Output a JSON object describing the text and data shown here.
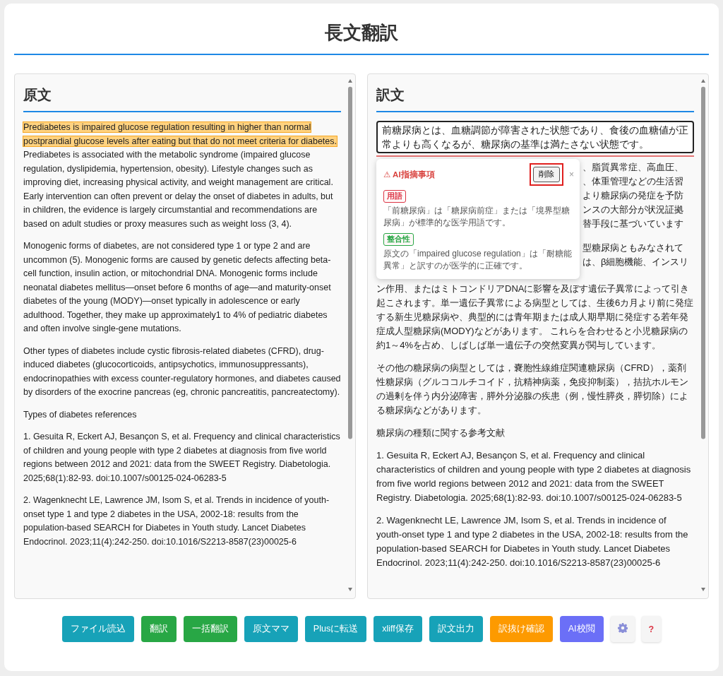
{
  "title": "長文翻訳",
  "source_panel": {
    "heading": "原文",
    "paragraphs": [
      {
        "segments": [
          {
            "text": "Prediabetes is impaired glucose regulation resulting in higher than normal postprandial glucose levels after eating but that do not meet criteria for diabetes.",
            "highlighted": true
          },
          {
            "text": " Prediabetes is associated with the metabolic syndrome (impaired glucose regulation, dyslipidemia, hypertension, obesity). Lifestyle changes such as improving diet, increasing physical activity, and weight management are critical. Early intervention can often prevent or delay the onset of diabetes in adults, but in children, the evidence is largely circumstantial and recommendations are based on adult studies or proxy measures such as weight loss (3, 4).",
            "highlighted": false
          }
        ]
      },
      {
        "segments": [
          {
            "text": "Monogenic forms of diabetes, are not considered type 1 or type 2 and are uncommon (5). Monogenic forms are caused by genetic defects affecting beta-cell function, insulin action, or mitochondrial DNA. Monogenic forms include neonatal diabetes mellitus—onset before 6 months of age—and maturity-onset diabetes of the young (MODY)—onset typically in adolescence or early adulthood. Together, they make up approximately1 to 4% of pediatric diabetes and often involve single-gene mutations.",
            "highlighted": false
          }
        ]
      },
      {
        "segments": [
          {
            "text": "Other types of diabetes include cystic fibrosis-related diabetes (CFRD), drug-induced diabetes (glucocorticoids, antipsychotics, immunosuppressants), endocrinopathies with excess counter-regulatory hormones, and diabetes caused by disorders of the exocrine pancreas (eg, chronic pancreatitis, pancreatectomy).",
            "highlighted": false
          }
        ]
      },
      {
        "segments": [
          {
            "text": "Types of diabetes references",
            "highlighted": false
          }
        ]
      },
      {
        "segments": [
          {
            "text": "1. Gesuita R, Eckert AJ, Besançon S, et al. Frequency and clinical characteristics of children and young people with type 2 diabetes at diagnosis from five world regions between 2012 and 2021: data from the SWEET Registry. Diabetologia. 2025;68(1):82-93. doi:10.1007/s00125-024-06283-5",
            "highlighted": false
          }
        ]
      },
      {
        "segments": [
          {
            "text": "2. Wagenknecht LE, Lawrence JM, Isom S, et al. Trends in incidence of youth-onset type 1 and type 2 diabetes in the USA, 2002-18: results from the population-based SEARCH for Diabetes in Youth study. Lancet Diabetes Endocrinol. 2023;11(4):242-250. doi:10.1016/S2213-8587(23)00025-6",
            "highlighted": false
          }
        ]
      }
    ]
  },
  "target_panel": {
    "heading": "訳文",
    "editor": {
      "value": "前糖尿病とは、血糖調節が障害された状態であり、食後の血糖値が正常よりも高くなるが、糖尿病の基準は満たさない状態です。",
      "flagged": true
    },
    "ai_popup": {
      "title": "⚠ AI指摘事項",
      "delete_button": "削除",
      "delete_highlighted": true,
      "close": "×",
      "issues": [
        {
          "tag": "用語",
          "color": "#dc3545",
          "text": "「前糖尿病」は「糖尿病前症」または「境界型糖尿病」が標準的な医学用語です。"
        },
        {
          "tag": "整合性",
          "color": "#28a745",
          "text": "原文の「impaired glucose regulation」は「耐糖能異常」と訳すのが医学的に正確です。"
        }
      ]
    },
    "covered_fragments": [
      [
        "、脂質異常症、高血圧、",
        "、体重管理などの生活習",
        "より糖尿病の発症を予防",
        "ンスの大部分が状況証拠",
        "替手段に基づいています"
      ],
      [
        "型糖尿病ともみなされて",
        "は、β細胞機能、インスリ"
      ]
    ],
    "paragraphs": [
      "ン作用、またはミトコンドリアDNAに影響を及ぼす遺伝子異常によって引き起こされます。単一遺伝子異常による病型としては、生後6カ月より前に発症する新生児糖尿病や、典型的には青年期または成人期早期に発症する若年発症成人型糖尿病(MODY)などがあります。 これらを合わせると小児糖尿病の約1～4%を占め、しばしば単一遺伝子の突然変異が関与しています。",
      "その他の糖尿病の病型としては，嚢胞性線維症関連糖尿病（CFRD），薬剤性糖尿病（グルココルチコイド，抗精神病薬，免疫抑制薬），拮抗ホルモンの過剰を伴う内分泌障害，膵外分泌腺の疾患（例，慢性膵炎，膵切除）による糖尿病などがあります。",
      "糖尿病の種類に関する参考文献",
      "1. Gesuita R, Eckert AJ, Besançon S, et al. Frequency and clinical characteristics of children and young people with type 2 diabetes at diagnosis from five world regions between 2012 and 2021: data from the SWEET Registry. Diabetologia. 2025;68(1):82-93. doi:10.1007/s00125-024-06283-5",
      "2. Wagenknecht LE, Lawrence JM, Isom S, et al. Trends in incidence of youth-onset type 1 and type 2 diabetes in the USA, 2002-18: results from the population-based SEARCH for Diabetes in Youth study. Lancet Diabetes Endocrinol. 2023;11(4):242-250. doi:10.1016/S2213-8587(23)00025-6"
    ]
  },
  "buttons": [
    {
      "kind": "text",
      "label": "ファイル読込",
      "color": "#17a2b8"
    },
    {
      "kind": "text",
      "label": "翻訳",
      "color": "#28a745"
    },
    {
      "kind": "text",
      "label": "一括翻訳",
      "color": "#28a745"
    },
    {
      "kind": "text",
      "label": "原文ママ",
      "color": "#17a2b8"
    },
    {
      "kind": "text",
      "label": "Plusに転送",
      "color": "#17a2b8"
    },
    {
      "kind": "text",
      "label": "xliff保存",
      "color": "#17a2b8"
    },
    {
      "kind": "text",
      "label": "訳文出力",
      "color": "#17a2b8"
    },
    {
      "kind": "text",
      "label": "訳抜け確認",
      "color": "#fd9a00"
    },
    {
      "kind": "text",
      "label": "AI校閲",
      "color": "#6b6ff7"
    },
    {
      "kind": "settings"
    },
    {
      "kind": "text-light",
      "label": "?",
      "color": "#dc3545"
    }
  ]
}
